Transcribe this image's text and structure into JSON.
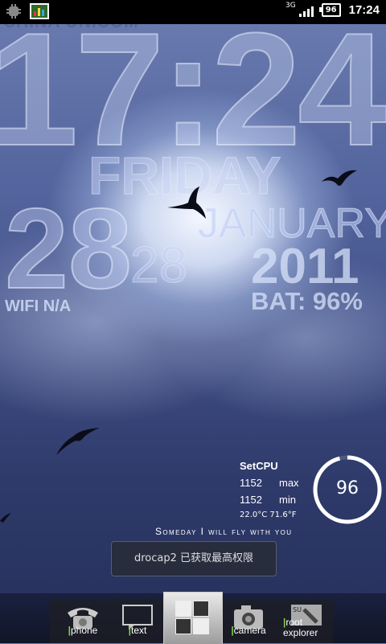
{
  "status_bar": {
    "network_type": "3G",
    "battery_level": "96",
    "time": "17:24"
  },
  "wallpaper_clock": {
    "carrier": "CHINA UNICOM",
    "time": "17:24",
    "weekday": "FRIDAY",
    "month": "JANUARY",
    "day_large": "28",
    "day_small": "28",
    "year": "2011",
    "wifi": "WIFI N/A",
    "battery": "BAT: 96%"
  },
  "setcpu_widget": {
    "title": "SetCPU",
    "max_value": "1152",
    "max_label": "max",
    "min_value": "1152",
    "min_label": "min",
    "temperature": "22.0°C 71.6°F",
    "gauge_value": "96",
    "gauge_fraction": 0.96
  },
  "tagline": "Someday I will fly with you",
  "toast": "drocap2 已获取最高权限",
  "dock": {
    "items": [
      {
        "label": "phone",
        "icon": "phone-icon"
      },
      {
        "label": "text",
        "icon": "message-icon"
      },
      {
        "label": "camera",
        "icon": "camera-icon"
      },
      {
        "label": "root explorer",
        "icon": "root-explorer-icon"
      }
    ],
    "home_icon": "app-drawer-icon"
  }
}
